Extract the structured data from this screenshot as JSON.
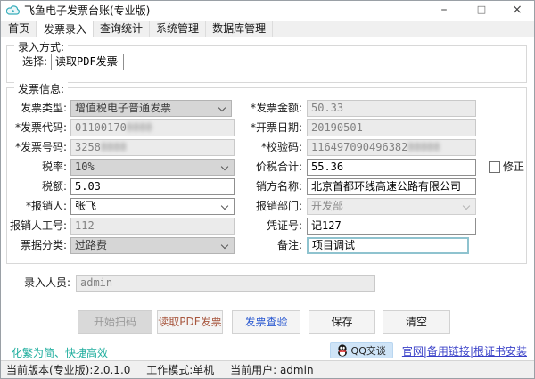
{
  "window": {
    "title": "飞鱼电子发票台账(专业版)",
    "controls": {
      "minimize": "–",
      "maximize": "□",
      "close": "×"
    }
  },
  "tabs": [
    {
      "label": "首页",
      "active": false
    },
    {
      "label": "发票录入",
      "active": true
    },
    {
      "label": "查询统计",
      "active": false
    },
    {
      "label": "系统管理",
      "active": false
    },
    {
      "label": "数据库管理",
      "active": false
    }
  ],
  "entry_mode": {
    "title": "录入方式:",
    "select_label": "选择:",
    "select_value": "读取PDF发票"
  },
  "invoice": {
    "title": "发票信息:",
    "type": {
      "label": "发票类型:",
      "value": "增值税电子普通发票"
    },
    "code": {
      "label": "*发票代码:",
      "value": "01100170",
      "masked": "8888"
    },
    "number": {
      "label": "*发票号码:",
      "value": "3258",
      "masked": "8888"
    },
    "tax_rate": {
      "label": "税率:",
      "value": "10%"
    },
    "tax_amount": {
      "label": "税额:",
      "value": "5.03"
    },
    "reimburser": {
      "label": "*报销人:",
      "value": "张飞"
    },
    "reimburser_id": {
      "label": "报销人工号:",
      "value": "112"
    },
    "category": {
      "label": "票据分类:",
      "value": "过路费"
    },
    "amount": {
      "label": "*发票金额:",
      "value": "50.33"
    },
    "date": {
      "label": "*开票日期:",
      "value": "20190501"
    },
    "check_code": {
      "label": "*校验码:",
      "value": "116497090496382",
      "masked": "88888"
    },
    "total": {
      "label": "价税合计:",
      "value": "55.36"
    },
    "correction": "修正",
    "seller": {
      "label": "销方名称:",
      "value": "北京首都环线高速公路有限公司"
    },
    "department": {
      "label": "报销部门:",
      "value": "开发部"
    },
    "voucher": {
      "label": "凭证号:",
      "value": "记127"
    },
    "remark": {
      "label": "备注:",
      "value": "项目调试"
    },
    "entry_user": {
      "label": "录入人员:",
      "value": "admin"
    }
  },
  "buttons": {
    "scan": "开始扫码",
    "read_pdf": "读取PDF发票",
    "verify": "发票查验",
    "save": "保存",
    "clear": "清空"
  },
  "footer": {
    "tagline": "化繁为简、快捷高效",
    "qq": "QQ交谈",
    "links": [
      "官网",
      "备用链接",
      "根证书安装"
    ],
    "separator": "|"
  },
  "status": {
    "version": "当前版本(专业版):2.0.1.0",
    "mode": "工作模式:单机",
    "user": "当前用户: admin"
  },
  "colors": {
    "accent_teal": "#1fae9e",
    "link_blue": "#3a41c8",
    "pdf_button_text": "#a8573f",
    "verify_button_text": "#2d5bd1",
    "focus_border": "#8fc3cf",
    "qq_button_bg": "#cfe4f7"
  }
}
